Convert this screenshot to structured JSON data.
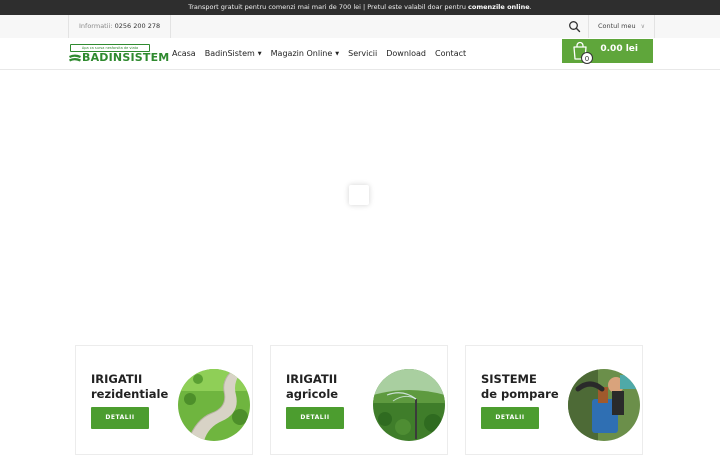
{
  "topbar": {
    "message": "Transport gratuit pentru comenzi mai mari de 700 lei | Pretul este valabil doar pentru",
    "emphasis": "comenzile online",
    "tail": "."
  },
  "info": {
    "label": "Informatii:",
    "phone": "0256 200 278"
  },
  "account": {
    "label": "Contul meu"
  },
  "logo": {
    "tagline": "Apa ca sursa nesfarsita de viata",
    "word": "BADINSISTEM"
  },
  "menu": {
    "items": [
      {
        "label": "Acasa",
        "dropdown": false
      },
      {
        "label": "BadinSistem",
        "dropdown": true
      },
      {
        "label": "Magazin Online",
        "dropdown": true
      },
      {
        "label": "Servicii",
        "dropdown": false
      },
      {
        "label": "Download",
        "dropdown": false
      },
      {
        "label": "Contact",
        "dropdown": false
      }
    ]
  },
  "cart": {
    "count": "0",
    "total": "0.00 lei"
  },
  "cards": [
    {
      "title_line1": "IRIGATII",
      "title_line2": "rezidentiale",
      "button": "DETALII",
      "image_icon": "residential-irrigation-image"
    },
    {
      "title_line1": "IRIGATII",
      "title_line2": "agricole",
      "button": "DETALII",
      "image_icon": "agricultural-irrigation-image"
    },
    {
      "title_line1": "SISTEME",
      "title_line2": "de pompare",
      "button": "DETALII",
      "image_icon": "pumping-system-image"
    }
  ],
  "colors": {
    "accent_green": "#5fa63b",
    "button_green": "#4c9d2f",
    "topbar_bg": "#2e2e2e",
    "logo_green": "#2f8a2f"
  }
}
